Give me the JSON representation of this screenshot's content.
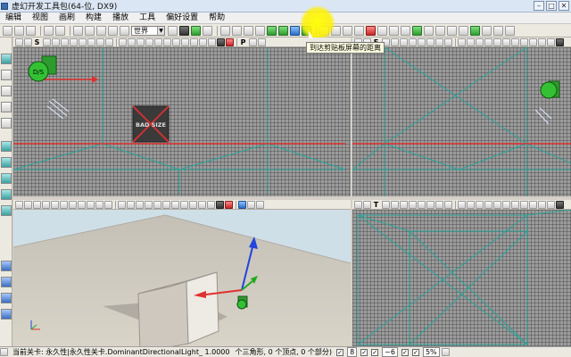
{
  "window": {
    "title": "虚幻开发工具包(64-位, DX9)",
    "buttons": [
      "–",
      "□",
      "✕"
    ]
  },
  "menu": [
    "编辑",
    "视图",
    "画刷",
    "构建",
    "播放",
    "工具",
    "偏好设置",
    "帮助"
  ],
  "toolbar": {
    "coord_system": "世界",
    "tooltip": "到达剪贴板屏幕的距离"
  },
  "viewports": {
    "top_left": {
      "letter_a": "S",
      "letter_b": "P",
      "label_texture": "BAD SIZE",
      "light_label": "D/S"
    },
    "top_right": {
      "letter_a": "F"
    },
    "bottom_right": {
      "letter_a": "T"
    }
  },
  "statusbar": {
    "level": "当前关卡: 永久性|永久性关卡.DominantDirectionalLight_ 1.0000",
    "counts": "个三角形, 0 个顶点, 0 个部分)",
    "grid_size": "8",
    "rotation_snap": "~6",
    "scale_snap": "5%"
  },
  "colors": {
    "selection_outline": "#f2f230",
    "grid_axis_red": "#e03030",
    "teal_lines": "#2aa39a"
  }
}
